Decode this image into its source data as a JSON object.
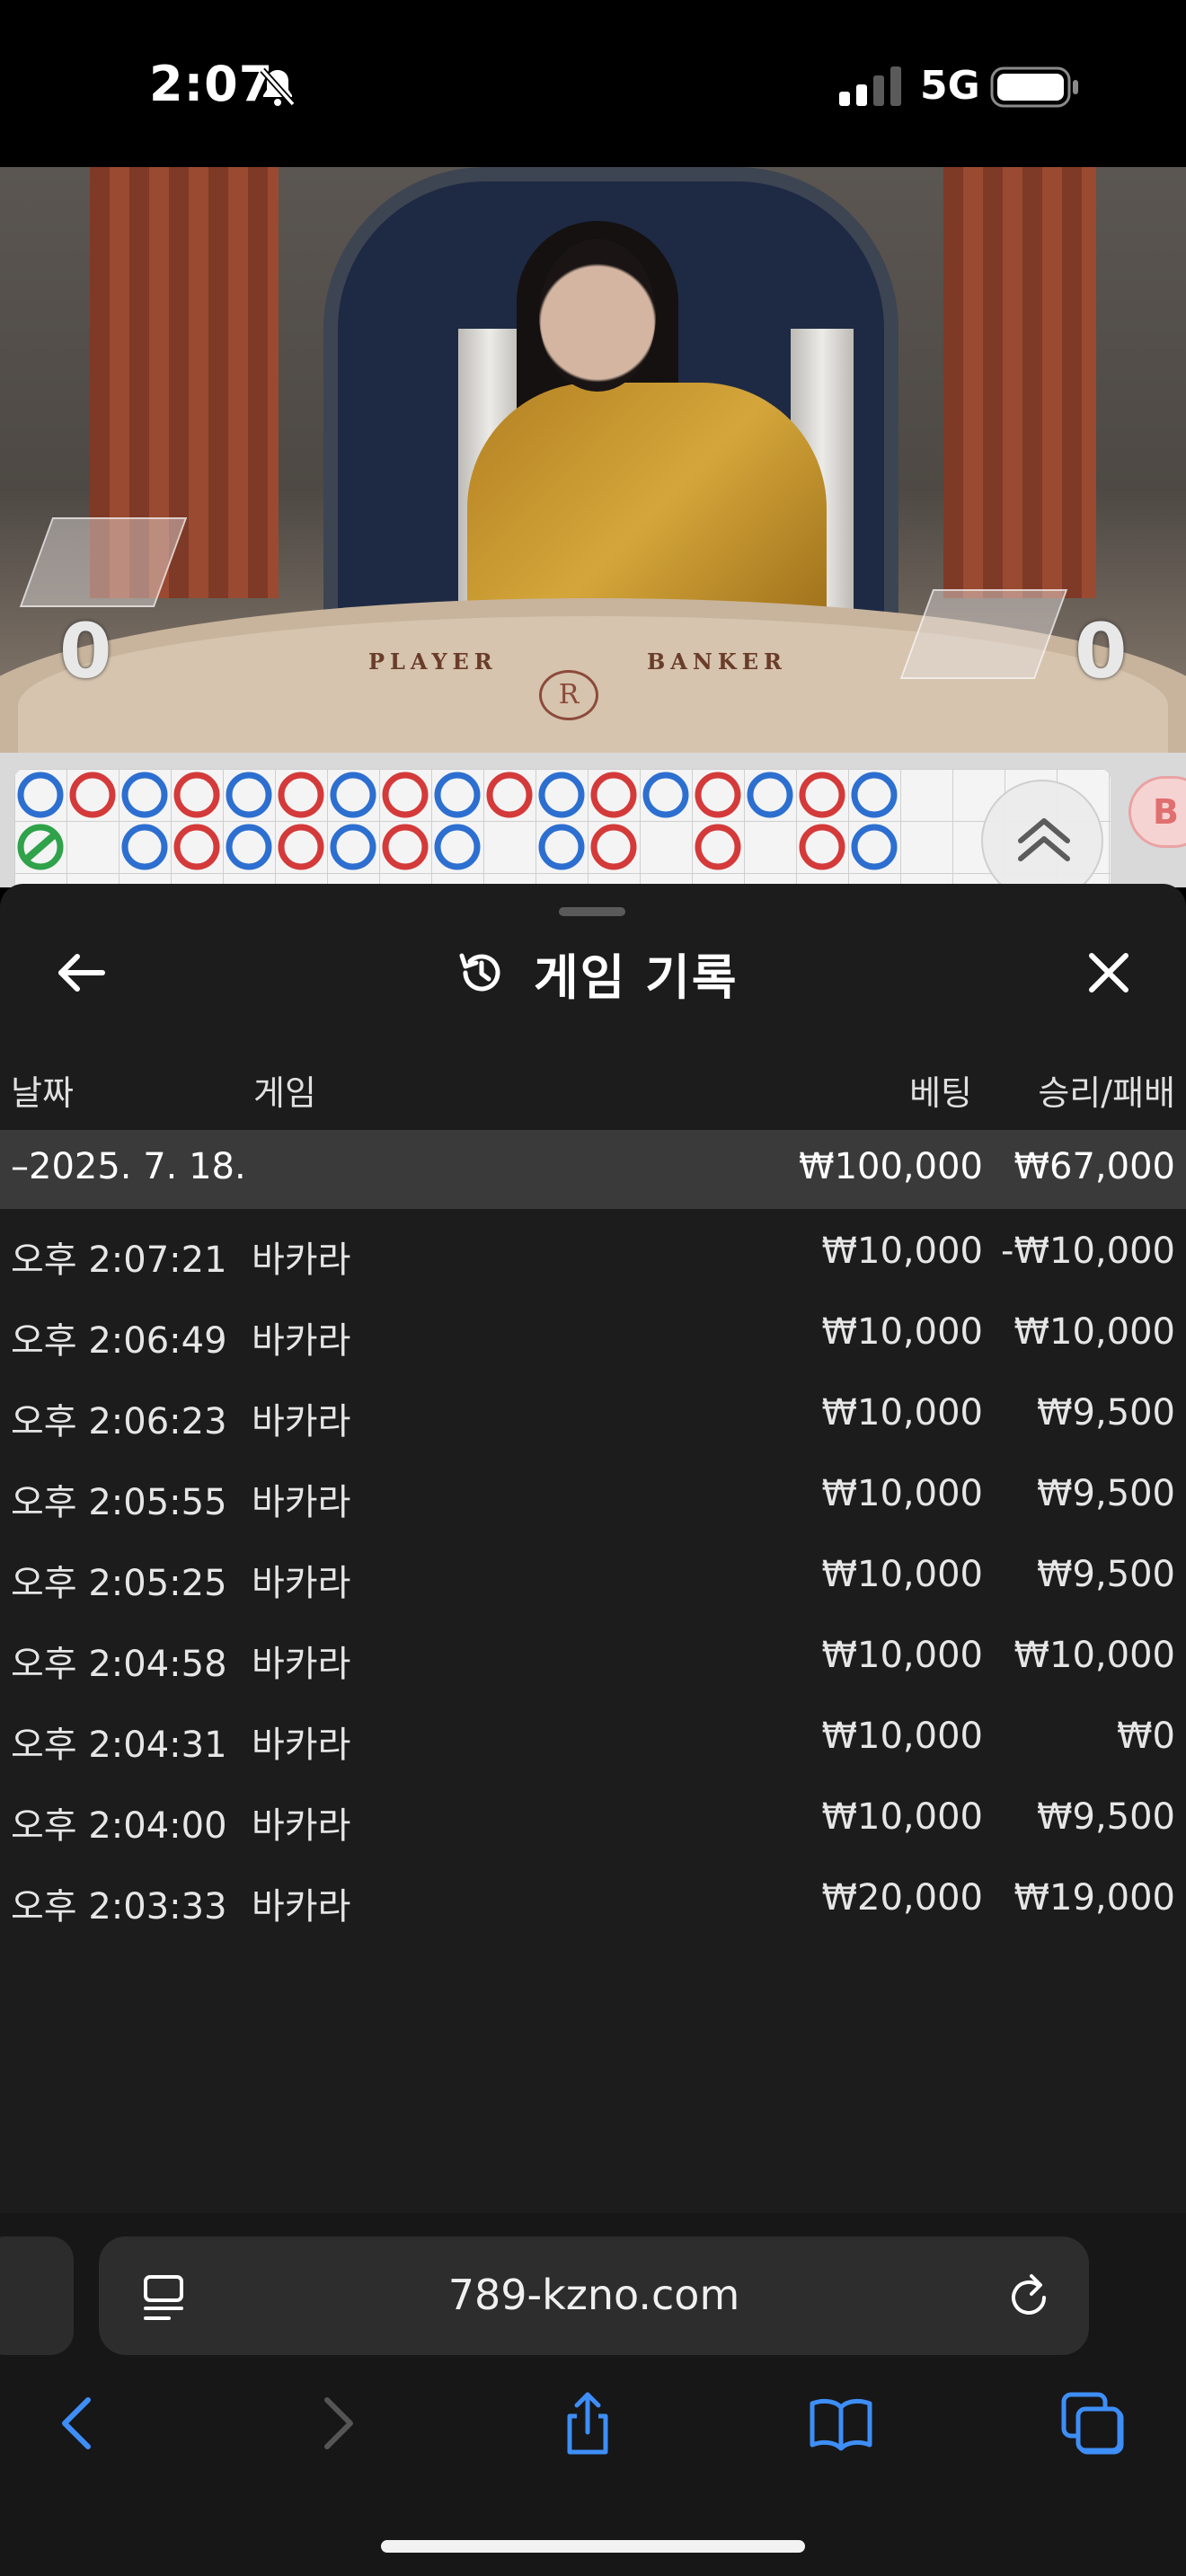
{
  "status_bar": {
    "time": "2:07",
    "network": "5G"
  },
  "video": {
    "table_player_text": "PLAYER",
    "table_banker_text": "BANKER",
    "player_score": "0",
    "banker_score": "0"
  },
  "road_map": {
    "side_chip_label": "B"
  },
  "history": {
    "title": "게임 기록",
    "columns": {
      "date": "날짜",
      "game": "게임",
      "bet": "베팅",
      "result": "승리/패배"
    },
    "summary": {
      "date": "–2025. 7. 18.",
      "bet": "₩100,000",
      "result": "₩67,000"
    },
    "rows": [
      {
        "time": "오후 2:07:21",
        "game": "바카라",
        "bet": "₩10,000",
        "result": "-₩10,000"
      },
      {
        "time": "오후 2:06:49",
        "game": "바카라",
        "bet": "₩10,000",
        "result": "₩10,000"
      },
      {
        "time": "오후 2:06:23",
        "game": "바카라",
        "bet": "₩10,000",
        "result": "₩9,500"
      },
      {
        "time": "오후 2:05:55",
        "game": "바카라",
        "bet": "₩10,000",
        "result": "₩9,500"
      },
      {
        "time": "오후 2:05:25",
        "game": "바카라",
        "bet": "₩10,000",
        "result": "₩9,500"
      },
      {
        "time": "오후 2:04:58",
        "game": "바카라",
        "bet": "₩10,000",
        "result": "₩10,000"
      },
      {
        "time": "오후 2:04:31",
        "game": "바카라",
        "bet": "₩10,000",
        "result": "₩0"
      },
      {
        "time": "오후 2:04:00",
        "game": "바카라",
        "bet": "₩10,000",
        "result": "₩9,500"
      },
      {
        "time": "오후 2:03:33",
        "game": "바카라",
        "bet": "₩20,000",
        "result": "₩19,000"
      }
    ]
  },
  "browser": {
    "url": "789-kzno.com"
  },
  "colors": {
    "accent_blue": "#3e8ef7",
    "road_blue": "#2d6fd0",
    "road_red": "#d43a3a",
    "road_green": "#2fa24a",
    "sheet_bg": "#1c1c1c",
    "summary_bg": "#3a3a3a"
  },
  "icons": {
    "status": [
      "bell-slash-icon",
      "signal-icon",
      "battery-icon"
    ],
    "sheet": [
      "back-arrow-icon",
      "history-icon",
      "close-icon"
    ],
    "browser": [
      "page-menu-icon",
      "reload-icon",
      "back-icon",
      "forward-icon",
      "share-icon",
      "bookmarks-icon",
      "tabs-icon"
    ]
  }
}
